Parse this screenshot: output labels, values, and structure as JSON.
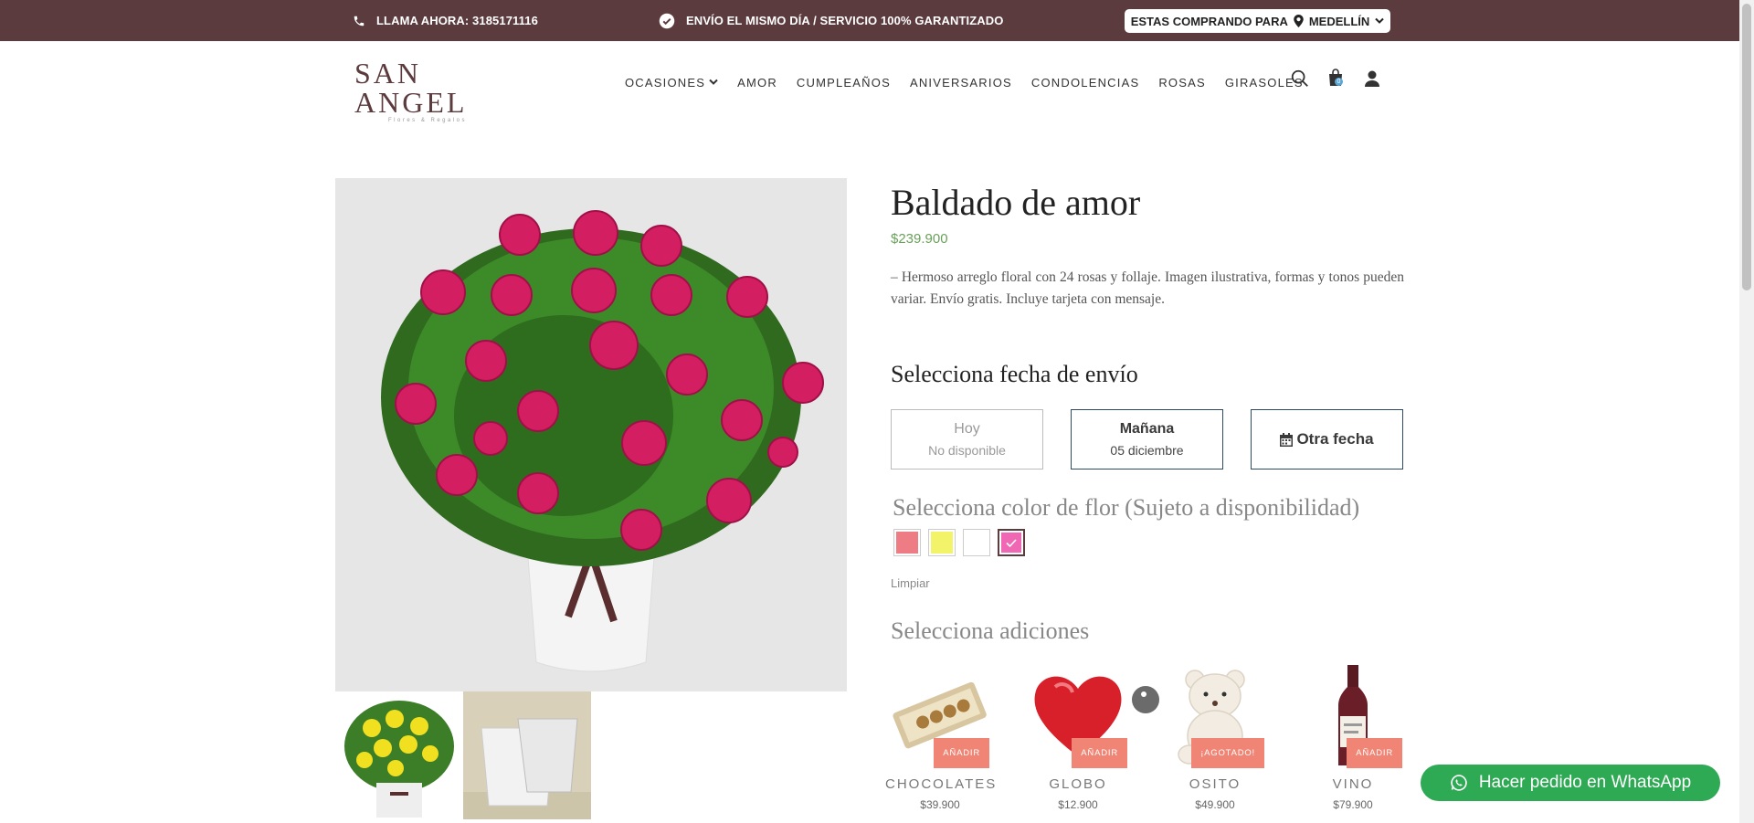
{
  "topbar": {
    "phone_label": "LLAMA AHORA: 3185171116",
    "guarantee_label": "ENVÍO EL MISMO DÍA / SERVICIO 100% GARANTIZADO",
    "store_prefix": "ESTAS COMPRANDO PARA",
    "store_city": "MEDELLÍN",
    "bg_color": "#5c3b3e"
  },
  "logo": {
    "name": "SAN ANGEL",
    "tagline": "Flores & Regalos"
  },
  "nav": {
    "items": [
      {
        "label": "OCASIONES",
        "has_dropdown": true
      },
      {
        "label": "AMOR"
      },
      {
        "label": "CUMPLEAÑOS"
      },
      {
        "label": "ANIVERSARIOS"
      },
      {
        "label": "CONDOLENCIAS"
      },
      {
        "label": "ROSAS"
      },
      {
        "label": "GIRASOLES"
      }
    ],
    "cart_count": "0",
    "icons": [
      "search-icon",
      "cart-icon",
      "user-icon"
    ]
  },
  "product": {
    "title": "Baldado de amor",
    "price": "$239.900",
    "description": "– Hermoso arreglo floral con 24 rosas y follaje. Imagen ilustrativa, formas y tonos pueden variar. Envío gratis. Incluye tarjeta con mensaje."
  },
  "delivery": {
    "heading": "Selecciona fecha de envío",
    "options": [
      {
        "title": "Hoy",
        "subtitle": "No disponible",
        "disabled": true
      },
      {
        "title": "Mañana",
        "subtitle": "05 diciembre",
        "disabled": false
      },
      {
        "title": "Otra fecha",
        "icon": "calendar-icon"
      }
    ]
  },
  "color": {
    "heading": "Selecciona color de flor (Sujeto a disponibilidad)",
    "swatches": [
      {
        "color": "#ee7c85",
        "selected": false
      },
      {
        "color": "#f3f36a",
        "selected": false
      },
      {
        "color": "#ffffff",
        "selected": false
      },
      {
        "color": "#f067b4",
        "selected": true
      }
    ],
    "clear_label": "Limpiar"
  },
  "addons": {
    "heading": "Selecciona adiciones",
    "items": [
      {
        "name": "CHOCOLATES",
        "price": "$39.900",
        "button": "AÑADIR"
      },
      {
        "name": "GLOBO",
        "price": "$12.900",
        "button": "AÑADIR"
      },
      {
        "name": "OSITO",
        "price": "$49.900",
        "button": "¡AGOTADO!"
      },
      {
        "name": "VINO",
        "price": "$79.900",
        "button": "AÑADIR"
      }
    ]
  },
  "whatsapp": {
    "label": "Hacer pedido en WhatsApp",
    "color": "#2eaa54"
  }
}
